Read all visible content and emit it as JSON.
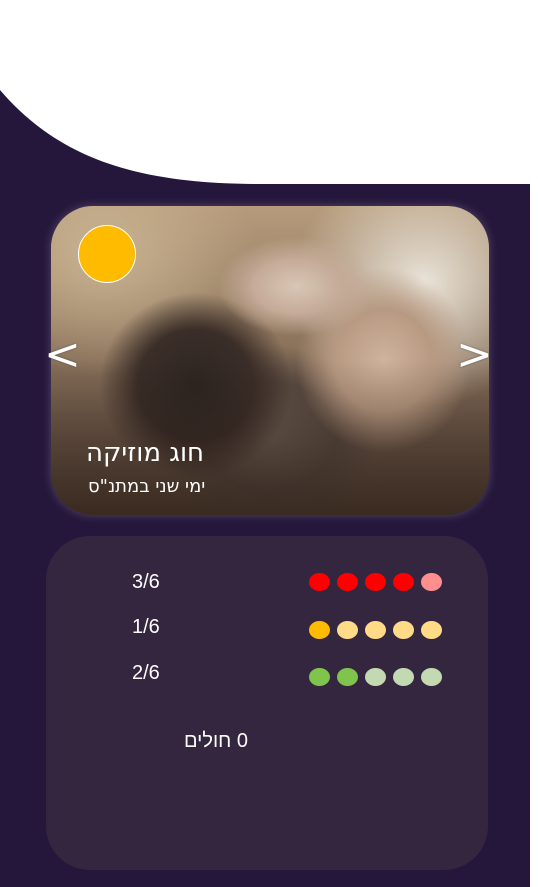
{
  "activity": {
    "title": "חוג מוזיקה",
    "subtitle": "ימי שני במתנ\"ס",
    "status_color": "#ffbb00",
    "nav_prev_label": "<",
    "nav_next_label": ">"
  },
  "stats": {
    "rows": [
      {
        "value": "3/6",
        "dot_colors": [
          "#ff0000",
          "#ff0000",
          "#ff0000",
          "#ff0000",
          "#ff8f8f"
        ]
      },
      {
        "value": "1/6",
        "dot_colors": [
          "#ffbb00",
          "#ffdb88",
          "#ffdb88",
          "#ffdb88",
          "#ffdb88"
        ]
      },
      {
        "value": "2/6",
        "dot_colors": [
          "#7ec44d",
          "#7ec44d",
          "#c3d9b2",
          "#c3d9b2",
          "#c3d9b2"
        ]
      }
    ],
    "patients_label": "0 חולים"
  },
  "colors": {
    "background": "#25163b",
    "stats_panel": "#35263f"
  }
}
